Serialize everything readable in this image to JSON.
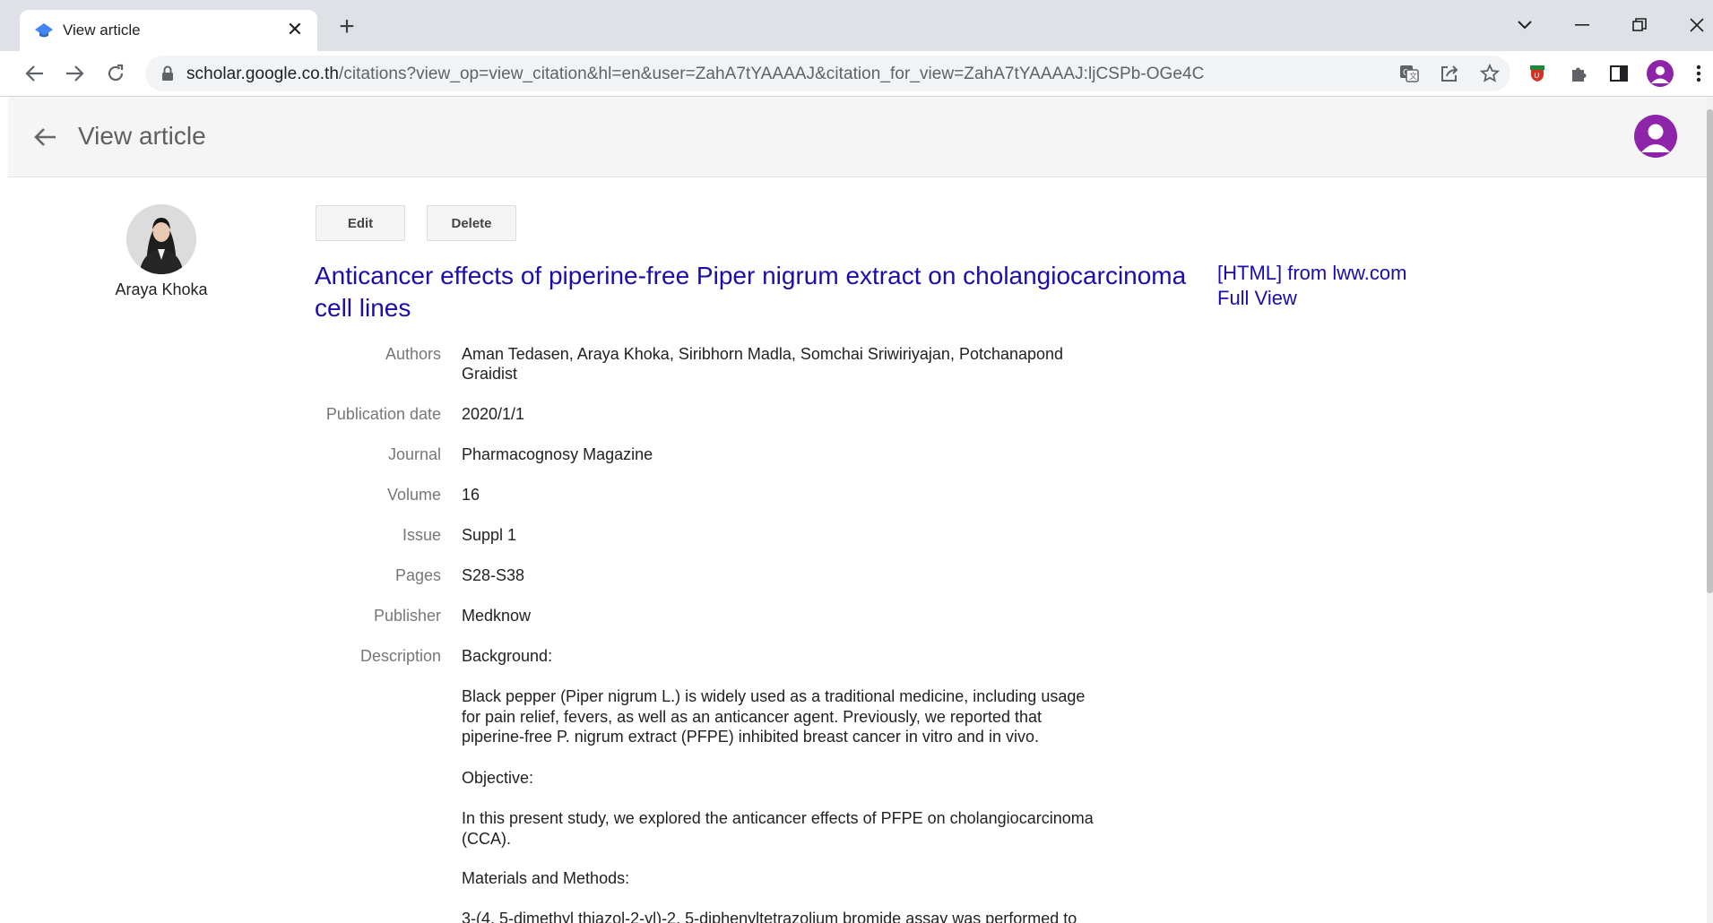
{
  "browser": {
    "tab_title": "View article",
    "tab_close": "✕",
    "new_tab": "+",
    "url_host": "scholar.google.co.th",
    "url_path": "/citations?view_op=view_citation&hl=en&user=ZahA7tYAAAAJ&citation_for_view=ZahA7tYAAAAJ:ljCSPb-OGe4C"
  },
  "header": {
    "title": "View article"
  },
  "profile": {
    "name": "Araya Khoka"
  },
  "actions": {
    "edit_label": "Edit",
    "delete_label": "Delete"
  },
  "article": {
    "title": "Anticancer effects of piperine-free Piper nigrum extract on cholangiocarcinoma cell lines",
    "links": {
      "html": "[HTML] from lww.com",
      "full_view": "Full View"
    },
    "fields": [
      {
        "label": "Authors",
        "value": "Aman Tedasen, Araya Khoka, Siribhorn Madla, Somchai Sriwiriyajan, Potchanapond Graidist"
      },
      {
        "label": "Publication date",
        "value": "2020/1/1"
      },
      {
        "label": "Journal",
        "value": "Pharmacognosy Magazine"
      },
      {
        "label": "Volume",
        "value": "16"
      },
      {
        "label": "Issue",
        "value": "Suppl 1"
      },
      {
        "label": "Pages",
        "value": "S28-S38"
      },
      {
        "label": "Publisher",
        "value": "Medknow"
      },
      {
        "label": "Description",
        "value": "Background:"
      }
    ],
    "description": [
      "Black pepper (Piper nigrum L.) is widely used as a traditional medicine, including usage for pain relief, fevers, as well as an anticancer agent. Previously, we reported that piperine-free P. nigrum extract (PFPE) inhibited breast cancer in vitro and in vivo.",
      "Objective:",
      "In this present study, we explored the anticancer effects of PFPE on cholangiocarcinoma (CCA).",
      "Materials and Methods:",
      "3-(4, 5-dimethyl thiazol-2-yl)-2, 5-diphenyltetrazolium bromide assay was performed to"
    ]
  },
  "colors": {
    "link": "#1a0dab",
    "avatar": "#8e24aa",
    "scholar_blue": "#4285f4"
  }
}
